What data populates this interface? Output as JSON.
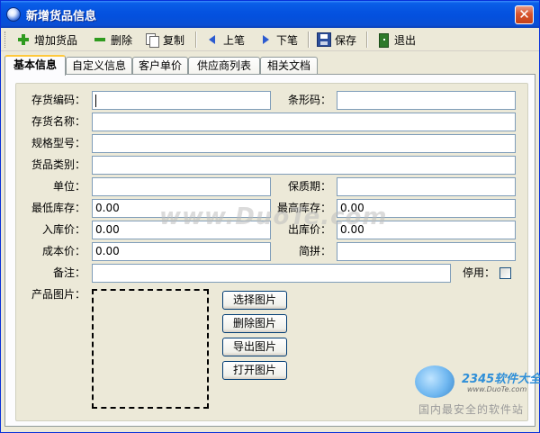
{
  "window": {
    "title": "新增货品信息",
    "close_glyph": "✕"
  },
  "toolbar": {
    "add": "增加货品",
    "delete": "删除",
    "copy": "复制",
    "prev": "上笔",
    "next": "下笔",
    "save": "保存",
    "exit": "退出"
  },
  "tabs": [
    "基本信息",
    "自定义信息",
    "客户单价",
    "供应商列表",
    "相关文档"
  ],
  "form": {
    "code_label": "存货编码：",
    "code_value": "",
    "barcode_label": "条形码：",
    "barcode_value": "",
    "name_label": "存货名称：",
    "name_value": "",
    "spec_label": "规格型号：",
    "spec_value": "",
    "category_label": "货品类别：",
    "category_value": "",
    "unit_label": "单位：",
    "unit_value": "",
    "shelf_label": "保质期：",
    "shelf_value": "",
    "min_stock_label": "最低库存：",
    "min_stock_value": "0.00",
    "max_stock_label": "最高库存：",
    "max_stock_value": "0.00",
    "in_price_label": "入库价：",
    "in_price_value": "0.00",
    "out_price_label": "出库价：",
    "out_price_value": "0.00",
    "cost_label": "成本价：",
    "cost_value": "0.00",
    "pinyin_label": "简拼：",
    "pinyin_value": "",
    "remark_label": "备注：",
    "remark_value": "",
    "disabled_label": "停用：",
    "disabled_checked": false,
    "image_label": "产品图片："
  },
  "image_buttons": {
    "select": "选择图片",
    "delete": "删除图片",
    "export": "导出图片",
    "open": "打开图片"
  },
  "watermark": "www.DuoTe.com",
  "branding": {
    "name": "2345软件大全",
    "url": "www.DuoTe.com",
    "slogan": "国内最安全的软件站"
  }
}
